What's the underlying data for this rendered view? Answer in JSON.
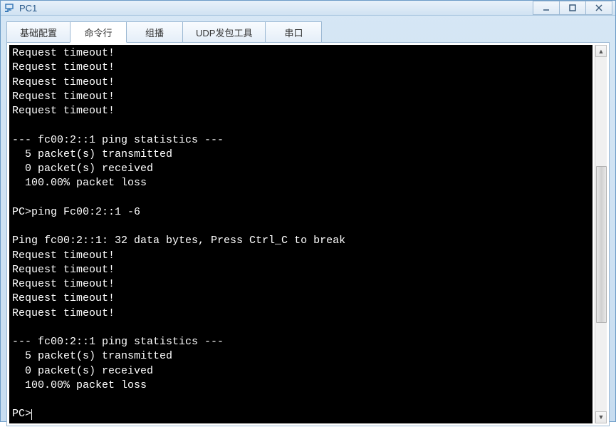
{
  "window": {
    "title": "PC1"
  },
  "tabs": {
    "basic": "基础配置",
    "cli": "命令行",
    "multicast": "组播",
    "udp": "UDP发包工具",
    "serial": "串口"
  },
  "terminal": {
    "lines": [
      "Request timeout!",
      "Request timeout!",
      "Request timeout!",
      "Request timeout!",
      "Request timeout!",
      "",
      "--- fc00:2::1 ping statistics ---",
      "  5 packet(s) transmitted",
      "  0 packet(s) received",
      "  100.00% packet loss",
      "",
      "PC>ping Fc00:2::1 -6",
      "",
      "Ping fc00:2::1: 32 data bytes, Press Ctrl_C to break",
      "Request timeout!",
      "Request timeout!",
      "Request timeout!",
      "Request timeout!",
      "Request timeout!",
      "",
      "--- fc00:2::1 ping statistics ---",
      "  5 packet(s) transmitted",
      "  0 packet(s) received",
      "  100.00% packet loss",
      "",
      "PC>"
    ],
    "prompt": "PC>"
  }
}
